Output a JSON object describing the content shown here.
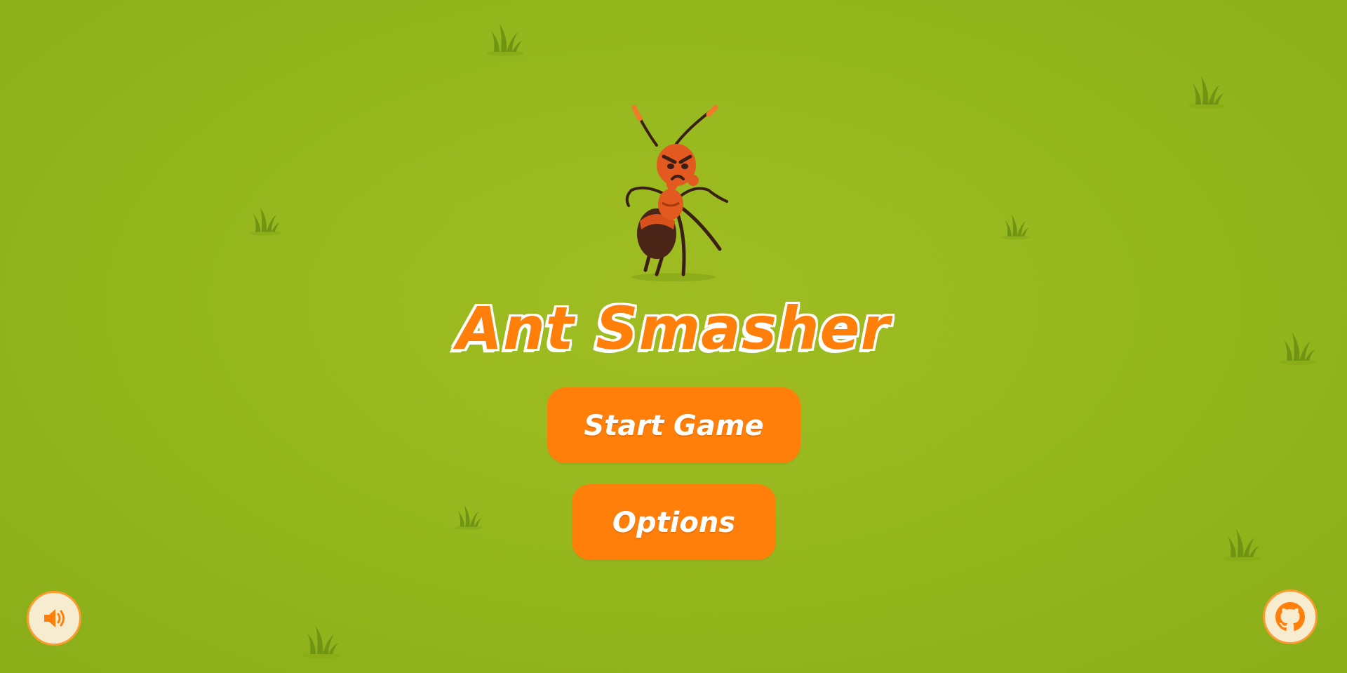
{
  "game": {
    "title": "Ant Smasher",
    "mascot": "angry-ant"
  },
  "menu": {
    "start_label": "Start Game",
    "options_label": "Options"
  },
  "corner_buttons": {
    "sound_icon": "speaker-icon",
    "github_icon": "github-icon"
  },
  "colors": {
    "accent": "#ff7f0a",
    "grass": "#96b81e",
    "round_button_bg": "#f6eccf"
  }
}
